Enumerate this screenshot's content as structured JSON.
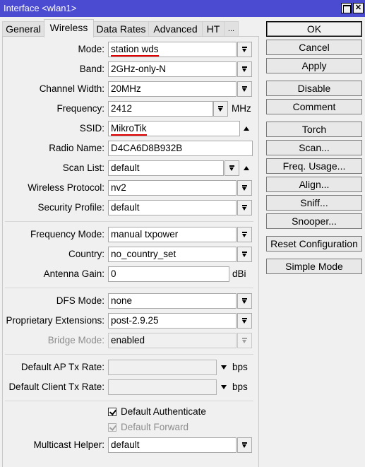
{
  "window": {
    "title": "Interface <wlan1>",
    "controls": [
      {
        "name": "maximize-icon",
        "glyph": ""
      },
      {
        "name": "close-icon",
        "glyph": "✕"
      }
    ]
  },
  "tabs": [
    {
      "label": "General",
      "active": false
    },
    {
      "label": "Wireless",
      "active": true
    },
    {
      "label": "Data Rates",
      "active": false
    },
    {
      "label": "Advanced",
      "active": false
    },
    {
      "label": "HT",
      "active": false
    },
    {
      "label": "...",
      "active": false
    }
  ],
  "form": {
    "mode": {
      "label": "Mode:",
      "value": "station wds"
    },
    "band": {
      "label": "Band:",
      "value": "2GHz-only-N"
    },
    "channel_width": {
      "label": "Channel Width:",
      "value": "20MHz"
    },
    "frequency": {
      "label": "Frequency:",
      "value": "2412",
      "unit": "MHz"
    },
    "ssid": {
      "label": "SSID:",
      "value": "MikroTik"
    },
    "radio_name": {
      "label": "Radio Name:",
      "value": "D4CA6D8B932B"
    },
    "scan_list": {
      "label": "Scan List:",
      "value": "default"
    },
    "wireless_protocol": {
      "label": "Wireless Protocol:",
      "value": "nv2"
    },
    "security_profile": {
      "label": "Security Profile:",
      "value": "default"
    },
    "frequency_mode": {
      "label": "Frequency Mode:",
      "value": "manual txpower"
    },
    "country": {
      "label": "Country:",
      "value": "no_country_set"
    },
    "antenna_gain": {
      "label": "Antenna Gain:",
      "value": "0",
      "unit": "dBi"
    },
    "dfs_mode": {
      "label": "DFS Mode:",
      "value": "none"
    },
    "proprietary_extensions": {
      "label": "Proprietary Extensions:",
      "value": "post-2.9.25"
    },
    "bridge_mode": {
      "label": "Bridge Mode:",
      "value": "enabled",
      "disabled": true
    },
    "default_ap_tx_rate": {
      "label": "Default AP Tx Rate:",
      "value": "",
      "unit": "bps"
    },
    "default_client_tx_rate": {
      "label": "Default Client Tx Rate:",
      "value": "",
      "unit": "bps"
    },
    "default_authenticate": {
      "label": "Default Authenticate",
      "checked": true
    },
    "default_forward": {
      "label": "Default Forward",
      "checked": true,
      "disabled": true
    },
    "multicast_helper": {
      "label": "Multicast Helper:",
      "value": "default"
    }
  },
  "buttons": {
    "ok": "OK",
    "cancel": "Cancel",
    "apply": "Apply",
    "disable": "Disable",
    "comment": "Comment",
    "torch": "Torch",
    "scan": "Scan...",
    "freq_usage": "Freq. Usage...",
    "align": "Align...",
    "sniff": "Sniff...",
    "snooper": "Snooper...",
    "reset_configuration": "Reset Configuration",
    "simple_mode": "Simple Mode"
  },
  "colors": {
    "titlebar": "#4b4bd1",
    "background": "#f0f0f0",
    "spellcheck_underline": "#e00000"
  }
}
